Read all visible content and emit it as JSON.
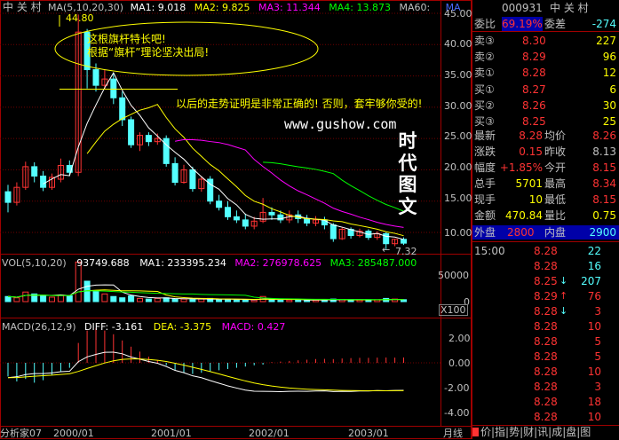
{
  "chart": {
    "stock_name": "中 关 村",
    "ma_legend": {
      "label": "MA(5,10,20,30)",
      "ma1": "MA1: 9.018",
      "ma2": "MA2: 9.825",
      "ma3": "MA3: 11.344",
      "ma4": "MA4: 13.873",
      "ma60": "MA60:",
      "ma60_tail": "MA"
    },
    "high_marker": "44.80",
    "low_marker": "7.32",
    "annotations": {
      "line1": "这根旗杆特长吧!",
      "line2": "根据“旗杆”理论坚决出局!",
      "line3": "以后的走势证明是非常正确的! 否则，套牢够你受的!"
    },
    "watermark_url": "www.gushow.com",
    "watermark_brand": [
      "时",
      "代",
      "图",
      "文"
    ],
    "price_axis": [
      "45.00",
      "40.00",
      "35.00",
      "30.00",
      "25.00",
      "20.00",
      "15.00",
      "10.00"
    ],
    "vol_legend": {
      "label": "VOL(5,10,20)",
      "value": "93749.688",
      "ma1": "MA1: 233395.234",
      "ma2": "MA2: 276978.625",
      "ma3": "MA3: 285487.000"
    },
    "vol_axis": [
      "50000",
      "0"
    ],
    "vol_unit": "X100",
    "macd_legend": {
      "label": "MACD(26,12,9)",
      "diff": "DIFF: -3.161",
      "dea": "DEA: -3.375",
      "macd": "MACD: 0.427"
    },
    "macd_axis": [
      "2.00",
      "0.00",
      "-2.00",
      "-4.00"
    ],
    "date_axis": {
      "start": "分析家07",
      "labels": [
        "2000/01",
        "2001/01",
        "2002/01",
        "2003/01"
      ],
      "right_label": "月线"
    },
    "colors": {
      "up": "#ff3333",
      "down": "#54ffff",
      "ma1": "#ffffff",
      "ma2": "#ffff00",
      "ma3": "#ff00ff",
      "ma4": "#00ff00",
      "annotation": "#ffff00"
    },
    "candles": [
      {
        "o": 16.5,
        "c": 14.8,
        "h": 17.6,
        "l": 13.2
      },
      {
        "o": 14.8,
        "c": 17.2,
        "h": 18.0,
        "l": 14.3
      },
      {
        "o": 17.2,
        "c": 20.5,
        "h": 21.3,
        "l": 16.8
      },
      {
        "o": 20.5,
        "c": 19.0,
        "h": 21.2,
        "l": 18.0
      },
      {
        "o": 19.0,
        "c": 17.2,
        "h": 19.8,
        "l": 16.6
      },
      {
        "o": 17.2,
        "c": 18.8,
        "h": 19.4,
        "l": 16.8
      },
      {
        "o": 18.5,
        "c": 20.7,
        "h": 21.8,
        "l": 18.0
      },
      {
        "o": 20.7,
        "c": 19.6,
        "h": 21.5,
        "l": 19.0
      },
      {
        "o": 19.6,
        "c": 42.0,
        "h": 44.8,
        "l": 19.0
      },
      {
        "o": 42.0,
        "c": 36.0,
        "h": 42.5,
        "l": 33.0
      },
      {
        "o": 36.0,
        "c": 33.5,
        "h": 37.0,
        "l": 32.5
      },
      {
        "o": 33.5,
        "c": 34.5,
        "h": 36.0,
        "l": 32.8
      },
      {
        "o": 34.5,
        "c": 31.5,
        "h": 35.5,
        "l": 30.5
      },
      {
        "o": 31.5,
        "c": 28.0,
        "h": 32.5,
        "l": 27.0
      },
      {
        "o": 28.0,
        "c": 24.0,
        "h": 28.5,
        "l": 23.5
      },
      {
        "o": 24.0,
        "c": 25.5,
        "h": 26.0,
        "l": 23.0
      },
      {
        "o": 25.5,
        "c": 24.5,
        "h": 26.0,
        "l": 23.8
      },
      {
        "o": 24.5,
        "c": 25.0,
        "h": 25.8,
        "l": 24.0
      },
      {
        "o": 25.0,
        "c": 21.0,
        "h": 25.5,
        "l": 20.5
      },
      {
        "o": 21.0,
        "c": 18.0,
        "h": 22.0,
        "l": 17.5
      },
      {
        "o": 18.0,
        "c": 20.0,
        "h": 20.8,
        "l": 17.8
      },
      {
        "o": 20.0,
        "c": 17.0,
        "h": 20.5,
        "l": 16.5
      },
      {
        "o": 17.0,
        "c": 18.5,
        "h": 19.0,
        "l": 16.5
      },
      {
        "o": 18.5,
        "c": 15.0,
        "h": 19.0,
        "l": 14.5
      },
      {
        "o": 15.0,
        "c": 14.0,
        "h": 16.0,
        "l": 13.5
      },
      {
        "o": 14.0,
        "c": 12.5,
        "h": 15.0,
        "l": 12.0
      },
      {
        "o": 12.5,
        "c": 12.0,
        "h": 13.5,
        "l": 11.5
      },
      {
        "o": 12.0,
        "c": 11.0,
        "h": 13.0,
        "l": 10.5
      },
      {
        "o": 11.0,
        "c": 11.8,
        "h": 12.5,
        "l": 10.5
      },
      {
        "o": 11.8,
        "c": 13.2,
        "h": 15.5,
        "l": 11.5
      },
      {
        "o": 13.2,
        "c": 12.8,
        "h": 14.0,
        "l": 12.0
      },
      {
        "o": 12.8,
        "c": 12.0,
        "h": 13.5,
        "l": 11.5
      },
      {
        "o": 12.0,
        "c": 12.8,
        "h": 13.5,
        "l": 11.5
      },
      {
        "o": 12.8,
        "c": 12.2,
        "h": 13.5,
        "l": 11.5
      },
      {
        "o": 12.2,
        "c": 11.5,
        "h": 12.8,
        "l": 11.0
      },
      {
        "o": 11.5,
        "c": 12.0,
        "h": 12.6,
        "l": 11.0
      },
      {
        "o": 12.0,
        "c": 11.2,
        "h": 12.5,
        "l": 10.5
      },
      {
        "o": 11.2,
        "c": 9.0,
        "h": 11.5,
        "l": 8.5
      },
      {
        "o": 9.0,
        "c": 10.5,
        "h": 10.8,
        "l": 8.8
      },
      {
        "o": 10.5,
        "c": 9.5,
        "h": 10.8,
        "l": 9.0
      },
      {
        "o": 9.5,
        "c": 10.2,
        "h": 10.6,
        "l": 9.2
      },
      {
        "o": 10.2,
        "c": 9.2,
        "h": 10.5,
        "l": 8.8
      },
      {
        "o": 9.2,
        "c": 9.8,
        "h": 10.2,
        "l": 8.8
      },
      {
        "o": 9.8,
        "c": 8.2,
        "h": 10.0,
        "l": 7.32
      },
      {
        "o": 8.2,
        "c": 8.9,
        "h": 9.0,
        "l": 7.8
      },
      {
        "o": 8.9,
        "c": 8.28,
        "h": 9.2,
        "l": 8.0
      }
    ],
    "volumes": [
      8000,
      6000,
      15000,
      12000,
      9000,
      7000,
      10000,
      9000,
      62000,
      32000,
      16000,
      12000,
      8000,
      6000,
      9000,
      5000,
      4000,
      5000,
      6000,
      4000,
      4000,
      3000,
      4000,
      5000,
      3000,
      4000,
      2500,
      3000,
      2500,
      8000,
      3000,
      2000,
      2500,
      3000,
      2000,
      2500,
      3000,
      4000,
      3500,
      3000,
      2500,
      2000,
      3000,
      5000,
      4000,
      3000
    ],
    "macd_bars": [
      -1.1,
      -1.5,
      -1.3,
      -1.6,
      -1.4,
      -1.0,
      -0.7,
      -0.4,
      1.6,
      2.6,
      2.8,
      2.6,
      2.3,
      1.8,
      1.3,
      0.9,
      0.5,
      0.2,
      -0.2,
      -0.6,
      -0.8,
      -0.9,
      -0.8,
      -0.7,
      -0.6,
      -0.5,
      -0.4,
      -0.3,
      -0.2,
      -0.15,
      0.05,
      0.1,
      0.15,
      0.2,
      0.25,
      0.3,
      0.32,
      0.3,
      0.35,
      0.38,
      0.4,
      0.4,
      0.42,
      0.43,
      0.42,
      0.427
    ]
  },
  "quote": {
    "code": "000931",
    "name": "中 关 村",
    "weibi": {
      "label": "委比",
      "value": "69.19%",
      "label2": "委差",
      "value2": "-274"
    },
    "sells": [
      {
        "label": "卖③",
        "price": "8.30",
        "vol": "227"
      },
      {
        "label": "卖②",
        "price": "8.29",
        "vol": "96"
      },
      {
        "label": "卖①",
        "price": "8.28",
        "vol": "12"
      }
    ],
    "buys": [
      {
        "label": "买①",
        "price": "8.27",
        "vol": "6"
      },
      {
        "label": "买②",
        "price": "8.26",
        "vol": "30"
      },
      {
        "label": "买③",
        "price": "8.25",
        "vol": "25"
      }
    ],
    "stats": [
      {
        "l1": "最新",
        "v1": "8.28",
        "c1": "#ff3333",
        "l2": "均价",
        "v2": "8.26",
        "c2": "#ff3333"
      },
      {
        "l1": "涨跌",
        "v1": "0.15",
        "c1": "#ff3333",
        "l2": "昨收",
        "v2": "8.13",
        "c2": "#c0c0c0"
      },
      {
        "l1": "幅度",
        "v1": "+1.85%",
        "c1": "#ff3333",
        "l2": "今开",
        "v2": "8.15",
        "c2": "#ff3333"
      },
      {
        "l1": "总手",
        "v1": "5701",
        "c1": "#ffff00",
        "l2": "最高",
        "v2": "8.34",
        "c2": "#ff3333"
      },
      {
        "l1": "现手",
        "v1": "10",
        "c1": "#ffff00",
        "l2": "最低",
        "v2": "8.15",
        "c2": "#ff3333"
      },
      {
        "l1": "金额",
        "v1": "470.84",
        "c1": "#ffff00",
        "l2": "量比",
        "v2": "0.75",
        "c2": "#ffff00"
      }
    ],
    "outer": {
      "label": "外盘",
      "value": "2800",
      "label2": "内盘",
      "value2": "2900"
    },
    "ticks": [
      {
        "time": "15:00",
        "price": "8.28",
        "arrow": "",
        "vol": "22"
      },
      {
        "time": "",
        "price": "8.28",
        "arrow": "",
        "vol": "16"
      },
      {
        "time": "",
        "price": "8.25",
        "arrow": "down",
        "vol": "207"
      },
      {
        "time": "",
        "price": "8.29",
        "arrow": "up",
        "vol": "76"
      },
      {
        "time": "",
        "price": "8.28",
        "arrow": "down",
        "vol": "3"
      },
      {
        "time": "",
        "price": "8.28",
        "arrow": "",
        "vol": "10"
      },
      {
        "time": "",
        "price": "8.28",
        "arrow": "",
        "vol": "5"
      },
      {
        "time": "",
        "price": "8.28",
        "arrow": "",
        "vol": "5"
      },
      {
        "time": "",
        "price": "8.28",
        "arrow": "",
        "vol": "10"
      },
      {
        "time": "",
        "price": "8.28",
        "arrow": "",
        "vol": "3"
      },
      {
        "time": "",
        "price": "8.28",
        "arrow": "",
        "vol": "18"
      },
      {
        "time": "",
        "price": "8.28",
        "arrow": "",
        "vol": "10"
      }
    ],
    "bottom_tabs": "价|指|势|财|讯|成|盘|图"
  }
}
